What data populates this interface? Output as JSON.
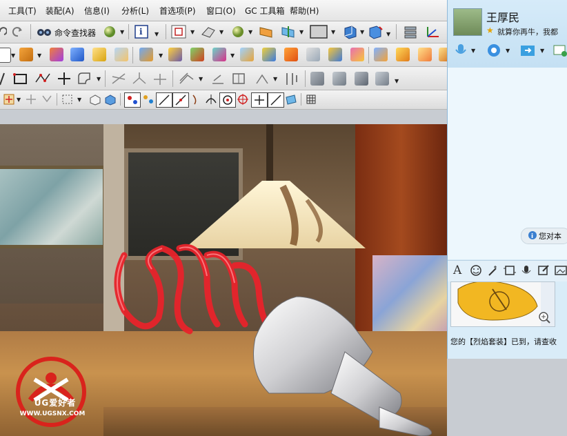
{
  "menubar": {
    "items": [
      "工具(T)",
      "装配(A)",
      "信息(I)",
      "分析(L)",
      "首选项(P)",
      "窗口(O)",
      "GC 工具箱",
      "帮助(H)"
    ]
  },
  "toolbar": {
    "command_finder_label": "命令查找器"
  },
  "watermark": {
    "logo_text": "UG爱好者",
    "url": "WWW.UGSNX.COM"
  },
  "chat": {
    "contact_name": "王厚民",
    "signature": "就算你再牛，我都",
    "notice": "您对本",
    "bottom_message": "您的【烈焰套装】已到，请查收"
  },
  "colors": {
    "coil_red": "#e8232b",
    "chat_bg": "#d9ecf8",
    "logo_red": "#d9231c"
  }
}
